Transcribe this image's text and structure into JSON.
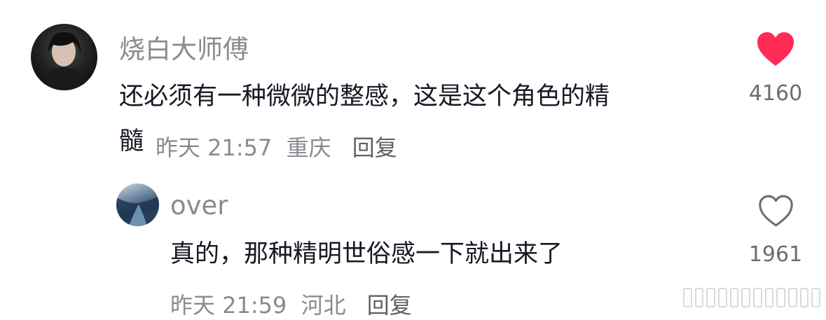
{
  "comments": {
    "main": {
      "username": "烧白大师傅",
      "text_line1": "还必须有一种微微的整感，这是这个角色的精",
      "text_line2": "髓",
      "time": "昨天 21:57",
      "location": "重庆",
      "reply_label": "回复",
      "likes": "4160",
      "liked": true,
      "like_color": "#fe2c55"
    },
    "reply": {
      "username": "over",
      "text": "真的，那种精明世俗感一下就出来了",
      "time": "昨天 21:59",
      "location": "河北",
      "reply_label": "回复",
      "likes": "1961",
      "liked": false
    }
  },
  "icons": {
    "liked": "heart-filled-icon",
    "unliked": "heart-outline-icon"
  }
}
